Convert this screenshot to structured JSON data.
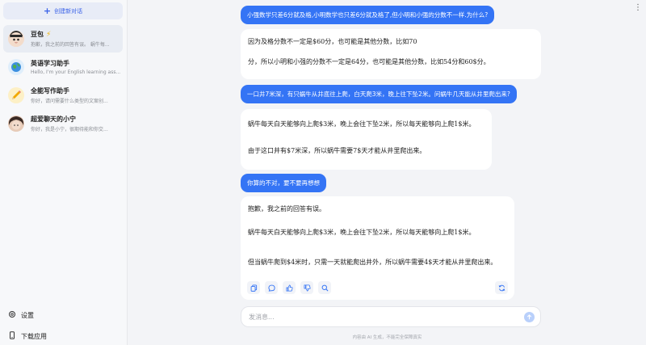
{
  "sidebar": {
    "new_chat_label": "创建新对话",
    "conversations": [
      {
        "title": "豆包",
        "subtitle": "抱歉，我之前的回答有误。 蜗牛每..."
      },
      {
        "title": "英语学习助手",
        "subtitle": "Hello, I'm your English learning ass..."
      },
      {
        "title": "全能写作助手",
        "subtitle": "你好，请问需要什么类型的文案创..."
      },
      {
        "title": "超爱聊天的小宁",
        "subtitle": "你好，我是小宁，很期待能和你交..."
      }
    ],
    "settings_label": "设置",
    "download_label": "下载应用"
  },
  "chat": {
    "messages": [
      {
        "role": "user",
        "text": "小强数学只差6分就及格,小明数学也只差6分就及格了,但小明和小强的分数不一样.为什么?"
      },
      {
        "role": "bot",
        "lines": [
          "因为及格分数不一定是$60分，也可能是其他分数，比如70",
          "分，所以小明和小强的分数不一定是64分，也可能是其他分数，比如54分和60$分。"
        ]
      },
      {
        "role": "user",
        "text": "一口井7米深，有只蜗牛从井底往上爬，白天爬3米，晚上往下坠2米。问蜗牛几天能从井里爬出来?"
      },
      {
        "role": "bot",
        "lines": [
          "蜗牛每天白天能够向上爬$3米，晚上会往下坠2米，所以每天能够向上爬1$米。",
          "由于这口井有$7米深，所以蜗牛需要7$天才能从井里爬出来。"
        ]
      },
      {
        "role": "user",
        "text": "你算的不对，要不要再想想"
      },
      {
        "role": "bot",
        "lines": [
          "抱歉，我之前的回答有误。",
          "蜗牛每天白天能够向上爬$3米，晚上会往下坠2米，所以每天能够向上爬1$米。",
          "但当蜗牛爬到$4米时，只需一天就能爬出井外，所以蜗牛需要4$天才能从井里爬出来。"
        ]
      }
    ]
  },
  "input": {
    "placeholder": "发消息..."
  },
  "footer": {
    "note": "内容由 AI 生成，不能完全保障真实"
  }
}
